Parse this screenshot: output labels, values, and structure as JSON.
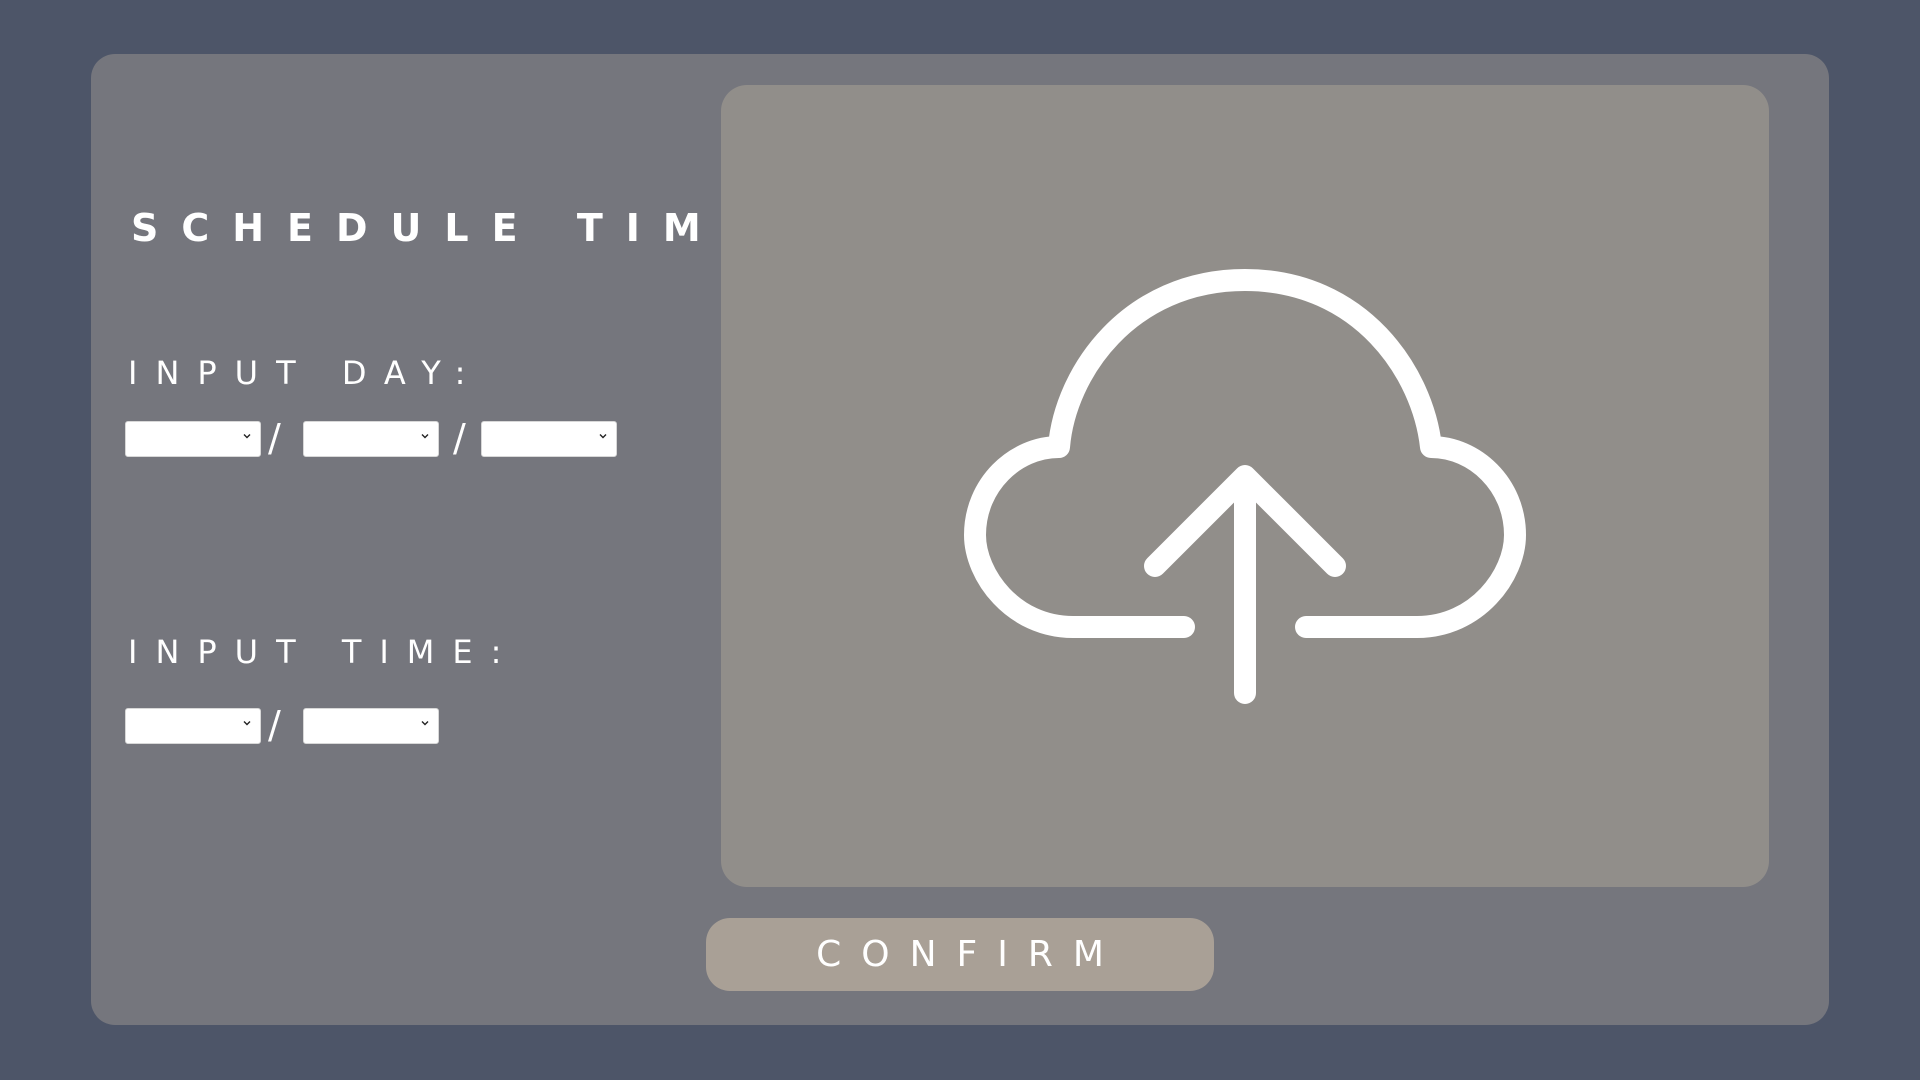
{
  "schedule": {
    "title": "SCHEDULE TIME",
    "day_label": "INPUT DAY:",
    "time_label": "INPUT TIME:",
    "day_selects": [
      {
        "value": ""
      },
      {
        "value": ""
      },
      {
        "value": ""
      }
    ],
    "day_separator": "/",
    "time_selects": [
      {
        "value": ""
      },
      {
        "value": ""
      }
    ],
    "time_separator": "/"
  },
  "upload": {
    "icon": "cloud-upload-icon"
  },
  "confirm": {
    "label": "CONFIRM"
  },
  "colors": {
    "background": "#4d5568",
    "panel": "#75767d",
    "upload_area": "#918e8a",
    "confirm_button": "#a9a096",
    "text": "#ffffff"
  }
}
